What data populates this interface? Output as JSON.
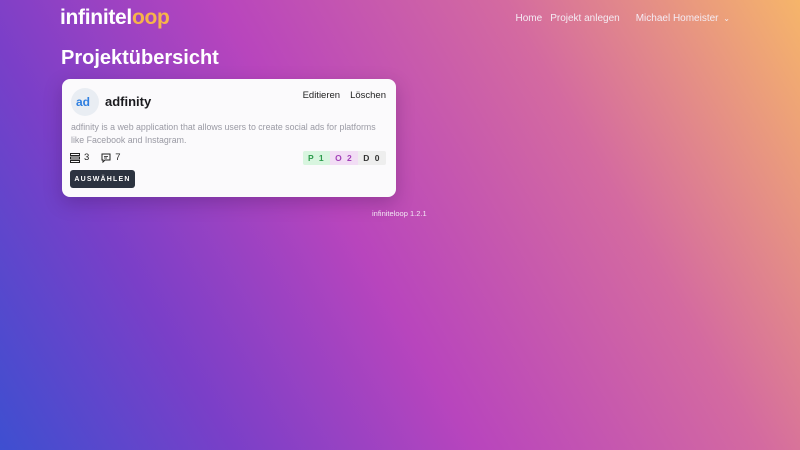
{
  "nav": {
    "logo_part1": "infinitel",
    "logo_part2": "oop",
    "home": "Home",
    "create_project": "Projekt anlegen",
    "user": "Michael Homeister",
    "user_icon": "chevron-down-icon"
  },
  "page": {
    "title": "Projektübersicht"
  },
  "project_card": {
    "logo_text": "ad",
    "title": "adfinity",
    "edit_label": "Editieren",
    "delete_label": "Löschen",
    "description": "adfinity is a web application that allows users to create social ads for platforms like Facebook and Instagram.",
    "stats": [
      {
        "icon": "list-icon",
        "value": "3"
      },
      {
        "icon": "comment-icon",
        "value": "7"
      }
    ],
    "badges": [
      {
        "label": "P 1",
        "color": "#2c9a4c"
      },
      {
        "label": "O 2",
        "color": "#a23fb8"
      },
      {
        "label": "D 0",
        "color": "#333333"
      }
    ],
    "select_label": "AUSWÄHLEN"
  },
  "footer": {
    "version": "infiniteloop 1.2.1"
  },
  "colors": {
    "brand_accent": "#f7b44a",
    "button_dark": "#2c3340"
  }
}
